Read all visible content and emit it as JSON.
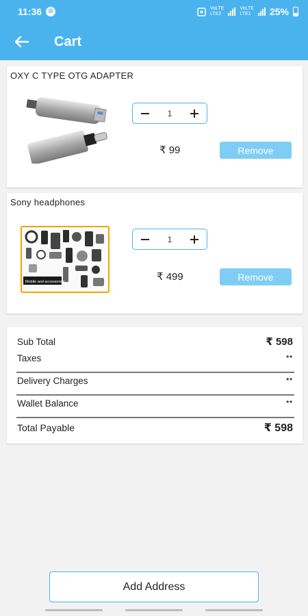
{
  "status_bar": {
    "time": "11:36",
    "sim1_tag": "VoLTE\nLTE2",
    "sim2_tag": "VoLTE\nLTE1",
    "battery_percent": "25%"
  },
  "header": {
    "title": "Cart",
    "back_icon": "arrow-left-icon"
  },
  "cart": {
    "items": [
      {
        "name": "OXY C TYPE OTG ADAPTER",
        "quantity": "1",
        "price": "₹ 99",
        "remove_label": "Remove",
        "image_icon": "usb-adapter-image"
      },
      {
        "name": "Sony headphones",
        "quantity": "1",
        "price": "₹ 499",
        "remove_label": "Remove",
        "image_icon": "mobile-accessories-image",
        "image_caption": "Mobile and accessories"
      }
    ]
  },
  "summary": {
    "sub_total_label": "Sub Total",
    "sub_total_value": "₹ 598",
    "taxes_label": "Taxes",
    "taxes_value": "**",
    "delivery_label": "Delivery Charges",
    "delivery_value": "**",
    "wallet_label": "Wallet Balance",
    "wallet_value": "**",
    "total_label": "Total Payable",
    "total_value": "₹ 598"
  },
  "footer": {
    "add_address_label": "Add Address"
  },
  "colors": {
    "primary": "#4ab3ee",
    "remove_button": "#7fcdf5",
    "background": "#f2f2f2"
  }
}
